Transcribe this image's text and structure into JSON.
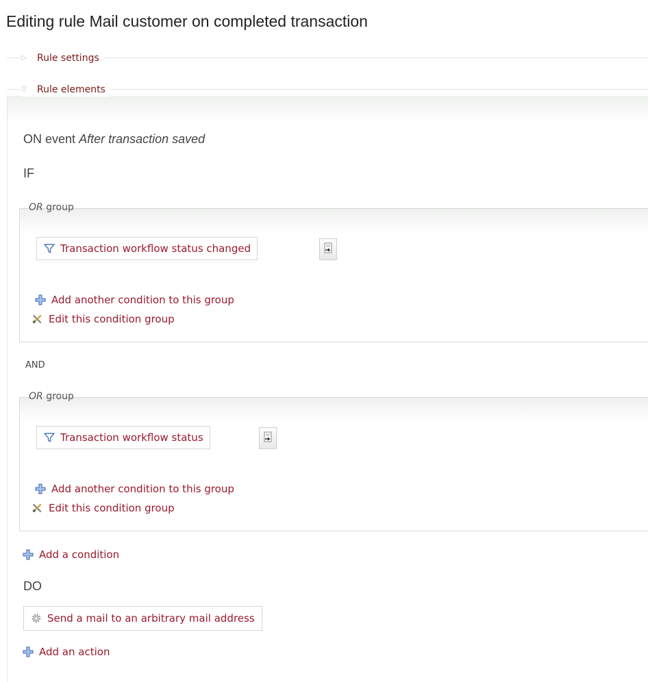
{
  "page": {
    "title": "Editing rule Mail customer on completed transaction"
  },
  "sections": {
    "rule_settings": {
      "label": "Rule settings",
      "state": "collapsed"
    },
    "rule_elements": {
      "label": "Rule elements",
      "state": "expanded"
    }
  },
  "event": {
    "prefix": "ON event",
    "name": "After transaction saved"
  },
  "if_label": "IF",
  "and_label": "AND",
  "do_label": "DO",
  "groups": [
    {
      "legend_em": "OR",
      "legend_rest": " group",
      "condition": "Transaction workflow status changed",
      "add_link": "Add another condition to this group",
      "edit_link": "Edit this condition group"
    },
    {
      "legend_em": "OR",
      "legend_rest": " group",
      "condition": "Transaction workflow status",
      "add_link": "Add another condition to this group",
      "edit_link": "Edit this condition group"
    }
  ],
  "add_condition": "Add a condition",
  "action": {
    "label": "Send a mail to an arbitrary mail address"
  },
  "add_action": "Add an action",
  "colors": {
    "link": "#9b1a2b",
    "plus_icon": "#3a66b5",
    "filter_icon": "#4a78c0"
  },
  "icons": {
    "condition": "filter-icon",
    "add": "plus-icon",
    "edit": "tools-icon",
    "move": "move-document-icon",
    "action": "gear-icon",
    "collapsed": "triangle-right-icon",
    "expanded": "triangle-down-icon"
  }
}
